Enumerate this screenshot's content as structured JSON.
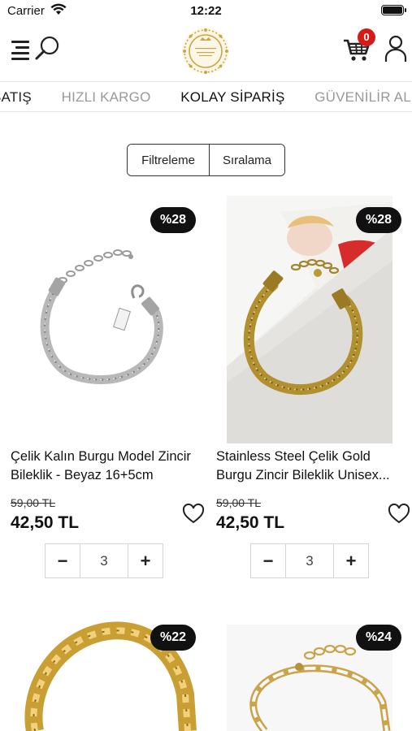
{
  "status_bar": {
    "carrier": "Carrier",
    "time": "12:22"
  },
  "header": {
    "cart_count": "0",
    "logo_alt": "logo-seal"
  },
  "marquee": {
    "items": [
      "SATIŞ",
      "HIZLI KARGO",
      "KOLAY SİPARİŞ",
      "GÜVENİLİR ALIŞVERİŞ"
    ]
  },
  "toolbar": {
    "filter_label": "Filtreleme",
    "sort_label": "Sıralama"
  },
  "colors": {
    "badge_red": "#d51a1a",
    "discount_bg": "#111111",
    "text": "#111111"
  },
  "products": [
    {
      "discount": "%28",
      "title": "Çelik Kalın Burgu Model Zincir Bileklik - Beyaz 16+5cm",
      "old_price": "59,00 TL",
      "price": "42,50 TL",
      "quantity": "3",
      "image": "silver-rope-bracelet"
    },
    {
      "discount": "%28",
      "title": "Stainless Steel Çelik Gold Burgu Zincir Bileklik Unisex...",
      "old_price": "59,00 TL",
      "price": "42,50 TL",
      "quantity": "3",
      "image": "gold-rope-bracelet-photo"
    },
    {
      "discount": "%22",
      "image": "gold-cuban-chain"
    },
    {
      "discount": "%24",
      "image": "gold-figaro-chain"
    }
  ],
  "icons": {
    "menu": "menu-icon",
    "search": "search-icon",
    "cart": "cart-icon",
    "user": "user-icon",
    "heart": "heart-icon",
    "minus": "minus-icon",
    "plus": "plus-icon"
  }
}
